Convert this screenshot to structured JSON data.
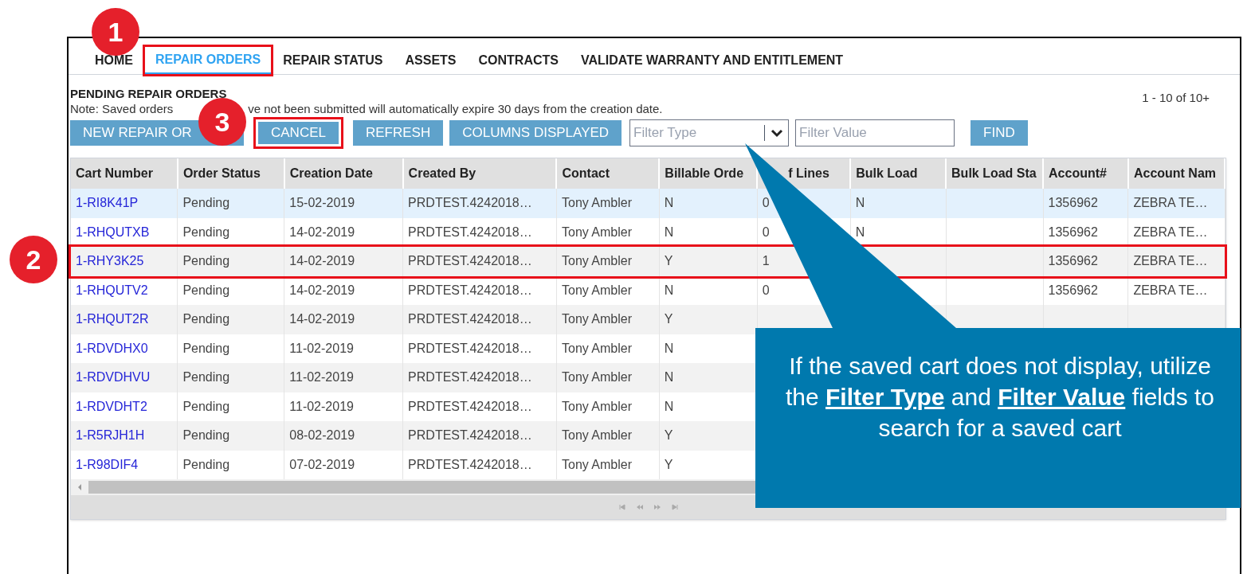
{
  "tabs": [
    {
      "label": "HOME",
      "selected": false,
      "highlighted": false
    },
    {
      "label": "REPAIR ORDERS",
      "selected": true,
      "highlighted": true
    },
    {
      "label": "REPAIR STATUS",
      "selected": false,
      "highlighted": false
    },
    {
      "label": "ASSETS",
      "selected": false,
      "highlighted": false
    },
    {
      "label": "CONTRACTS",
      "selected": false,
      "highlighted": false
    },
    {
      "label": "VALIDATE WARRANTY AND ENTITLEMENT",
      "selected": false,
      "highlighted": false
    }
  ],
  "section": {
    "title": "PENDING REPAIR ORDERS",
    "note": "Note: Saved orders",
    "note_rest": "ve not been submitted will automatically expire 30 days from the creation date.",
    "range": "1 - 10 of 10+"
  },
  "toolbar": {
    "buttons": [
      {
        "label": "NEW REPAIR OR",
        "highlighted": false
      },
      {
        "label": "CANCEL",
        "highlighted": true
      },
      {
        "label": "REFRESH",
        "highlighted": false
      },
      {
        "label": "COLUMNS DISPLAYED",
        "highlighted": false
      }
    ],
    "filter_type": {
      "placeholder": "Filter Type"
    },
    "filter_value": {
      "placeholder": "Filter Value"
    },
    "find": "FIND"
  },
  "table": {
    "columns": [
      "Cart Number",
      "Order Status",
      "Creation Date",
      "Created By",
      "Contact",
      "Billable Orde",
      "f Lines",
      "Bulk Load",
      "Bulk Load Sta",
      "Account#",
      "Account Nam"
    ],
    "rows": [
      {
        "selected": true,
        "highlighted": false,
        "cart_number": "1-RI8K41P",
        "order_status": "Pending",
        "creation_date": "15-02-2019",
        "created_by": "PRDTEST.4242018…",
        "contact": "Tony Ambler",
        "billable": "N",
        "lines": "0",
        "bulk_load": "N",
        "account": "1356962",
        "account_name": "ZEBRA TE…"
      },
      {
        "selected": false,
        "highlighted": false,
        "cart_number": "1-RHQUTXB",
        "order_status": "Pending",
        "creation_date": "14-02-2019",
        "created_by": "PRDTEST.4242018…",
        "contact": "Tony Ambler",
        "billable": "N",
        "lines": "0",
        "bulk_load": "N",
        "account": "1356962",
        "account_name": "ZEBRA TE…"
      },
      {
        "selected": false,
        "highlighted": true,
        "cart_number": "1-RHY3K25",
        "order_status": "Pending",
        "creation_date": "14-02-2019",
        "created_by": "PRDTEST.4242018…",
        "contact": "Tony Ambler",
        "billable": "Y",
        "lines": "1",
        "account": "1356962",
        "account_name": "ZEBRA TE…"
      },
      {
        "selected": false,
        "highlighted": false,
        "cart_number": "1-RHQUTV2",
        "order_status": "Pending",
        "creation_date": "14-02-2019",
        "created_by": "PRDTEST.4242018…",
        "contact": "Tony Ambler",
        "billable": "N",
        "lines": "0",
        "account": "1356962",
        "account_name": "ZEBRA TE…"
      },
      {
        "selected": false,
        "highlighted": false,
        "cart_number": "1-RHQUT2R",
        "order_status": "Pending",
        "creation_date": "14-02-2019",
        "created_by": "PRDTEST.4242018…",
        "contact": "Tony Ambler",
        "billable": "Y"
      },
      {
        "selected": false,
        "highlighted": false,
        "cart_number": "1-RDVDHX0",
        "order_status": "Pending",
        "creation_date": "11-02-2019",
        "created_by": "PRDTEST.4242018…",
        "contact": "Tony Ambler",
        "billable": "N"
      },
      {
        "selected": false,
        "highlighted": false,
        "cart_number": "1-RDVDHVU",
        "order_status": "Pending",
        "creation_date": "11-02-2019",
        "created_by": "PRDTEST.4242018…",
        "contact": "Tony Ambler",
        "billable": "N"
      },
      {
        "selected": false,
        "highlighted": false,
        "cart_number": "1-RDVDHT2",
        "order_status": "Pending",
        "creation_date": "11-02-2019",
        "created_by": "PRDTEST.4242018…",
        "contact": "Tony Ambler",
        "billable": "N"
      },
      {
        "selected": false,
        "highlighted": false,
        "cart_number": "1-R5RJH1H",
        "order_status": "Pending",
        "creation_date": "08-02-2019",
        "created_by": "PRDTEST.4242018…",
        "contact": "Tony Ambler",
        "billable": "Y"
      },
      {
        "selected": false,
        "highlighted": false,
        "cart_number": "1-R98DIF4",
        "order_status": "Pending",
        "creation_date": "07-02-2019",
        "created_by": "PRDTEST.4242018…",
        "contact": "Tony Ambler",
        "billable": "Y"
      }
    ]
  },
  "markers": [
    "1",
    "2",
    "3"
  ],
  "callout": "If the saved cart does not display, utilize the **Filter Type** and **Filter Value** fields to search for a saved cart"
}
